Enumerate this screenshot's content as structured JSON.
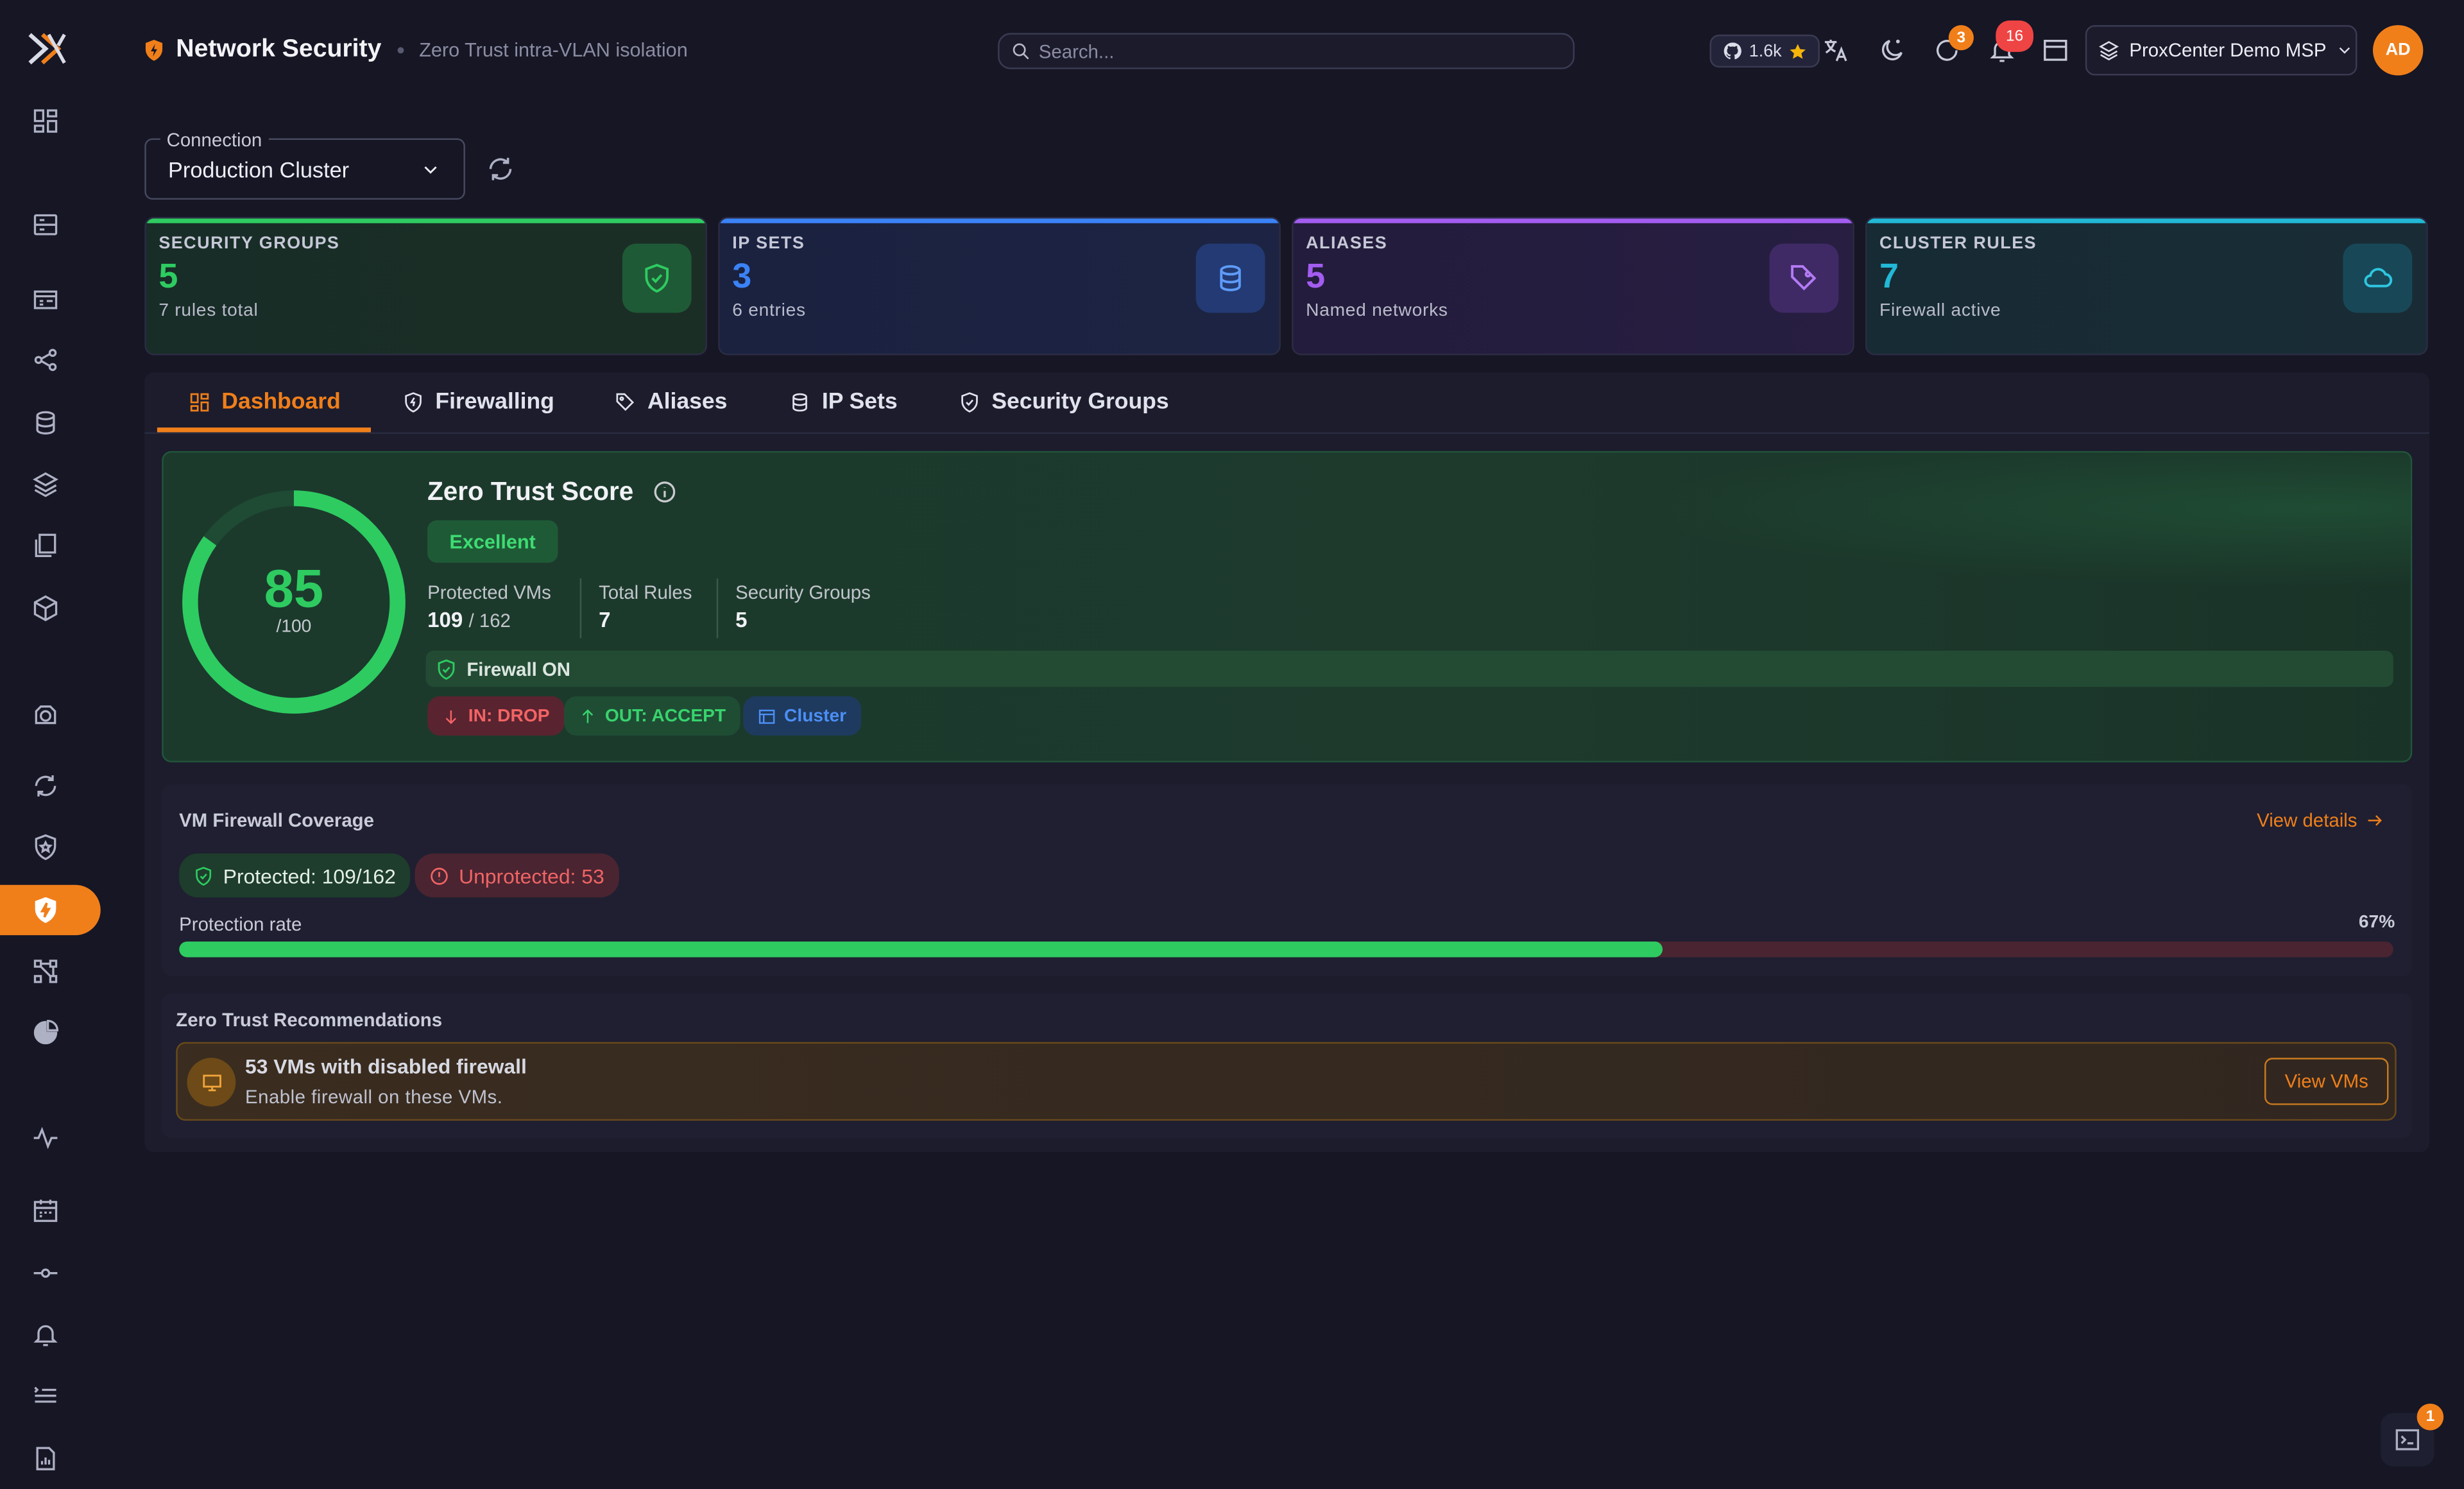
{
  "header": {
    "title": "Network Security",
    "subtitle": "Zero Trust intra-VLAN isolation",
    "search_placeholder": "Search...",
    "github_stars": "1.6k",
    "updates_count": "3",
    "notifications_count": "16",
    "tenant": "ProxCenter Demo MSP",
    "avatar_initials": "AD"
  },
  "connection": {
    "label": "Connection",
    "value": "Production Cluster"
  },
  "stats": [
    {
      "label": "SECURITY GROUPS",
      "value": "5",
      "sub": "7 rules total",
      "color": "#2ecb61"
    },
    {
      "label": "IP SETS",
      "value": "3",
      "sub": "6 entries",
      "color": "#3b82f6"
    },
    {
      "label": "ALIASES",
      "value": "5",
      "sub": "Named networks",
      "color": "#a35cf0"
    },
    {
      "label": "CLUSTER RULES",
      "value": "7",
      "sub": "Firewall active",
      "color": "#22b8d6"
    }
  ],
  "tabs": [
    {
      "label": "Dashboard",
      "icon": "dashboard-icon",
      "active": true
    },
    {
      "label": "Firewalling",
      "icon": "shield-icon"
    },
    {
      "label": "Aliases",
      "icon": "tag-icon"
    },
    {
      "label": "IP Sets",
      "icon": "database-icon"
    },
    {
      "label": "Security Groups",
      "icon": "shield-check-icon"
    }
  ],
  "zero_trust": {
    "title": "Zero Trust Score",
    "score": "85",
    "score_max": "/100",
    "score_fraction": 0.85,
    "rating": "Excellent",
    "protected_vms_label": "Protected VMs",
    "protected_vms": "109",
    "total_vms": "/ 162",
    "total_rules_label": "Total Rules",
    "total_rules": "7",
    "security_groups_label": "Security Groups",
    "security_groups": "5",
    "firewall_status": "Firewall ON",
    "policy_in": "IN: DROP",
    "policy_out": "OUT: ACCEPT",
    "scope": "Cluster"
  },
  "coverage": {
    "title": "VM Firewall Coverage",
    "view_details": "View details",
    "protected": "Protected: 109/162",
    "unprotected": "Unprotected: 53",
    "rate_label": "Protection rate",
    "rate_value": "67%",
    "rate_fraction": 0.67
  },
  "recommendations": {
    "title": "Zero Trust Recommendations",
    "items": [
      {
        "heading": "53 VMs with disabled firewall",
        "body": "Enable firewall on these VMs.",
        "action": "View VMs"
      }
    ]
  },
  "terminal_badge": "1",
  "colors": {
    "accent": "#f07f1a",
    "success": "#2ecb61",
    "danger": "#ef4444",
    "info": "#3b82f6"
  }
}
